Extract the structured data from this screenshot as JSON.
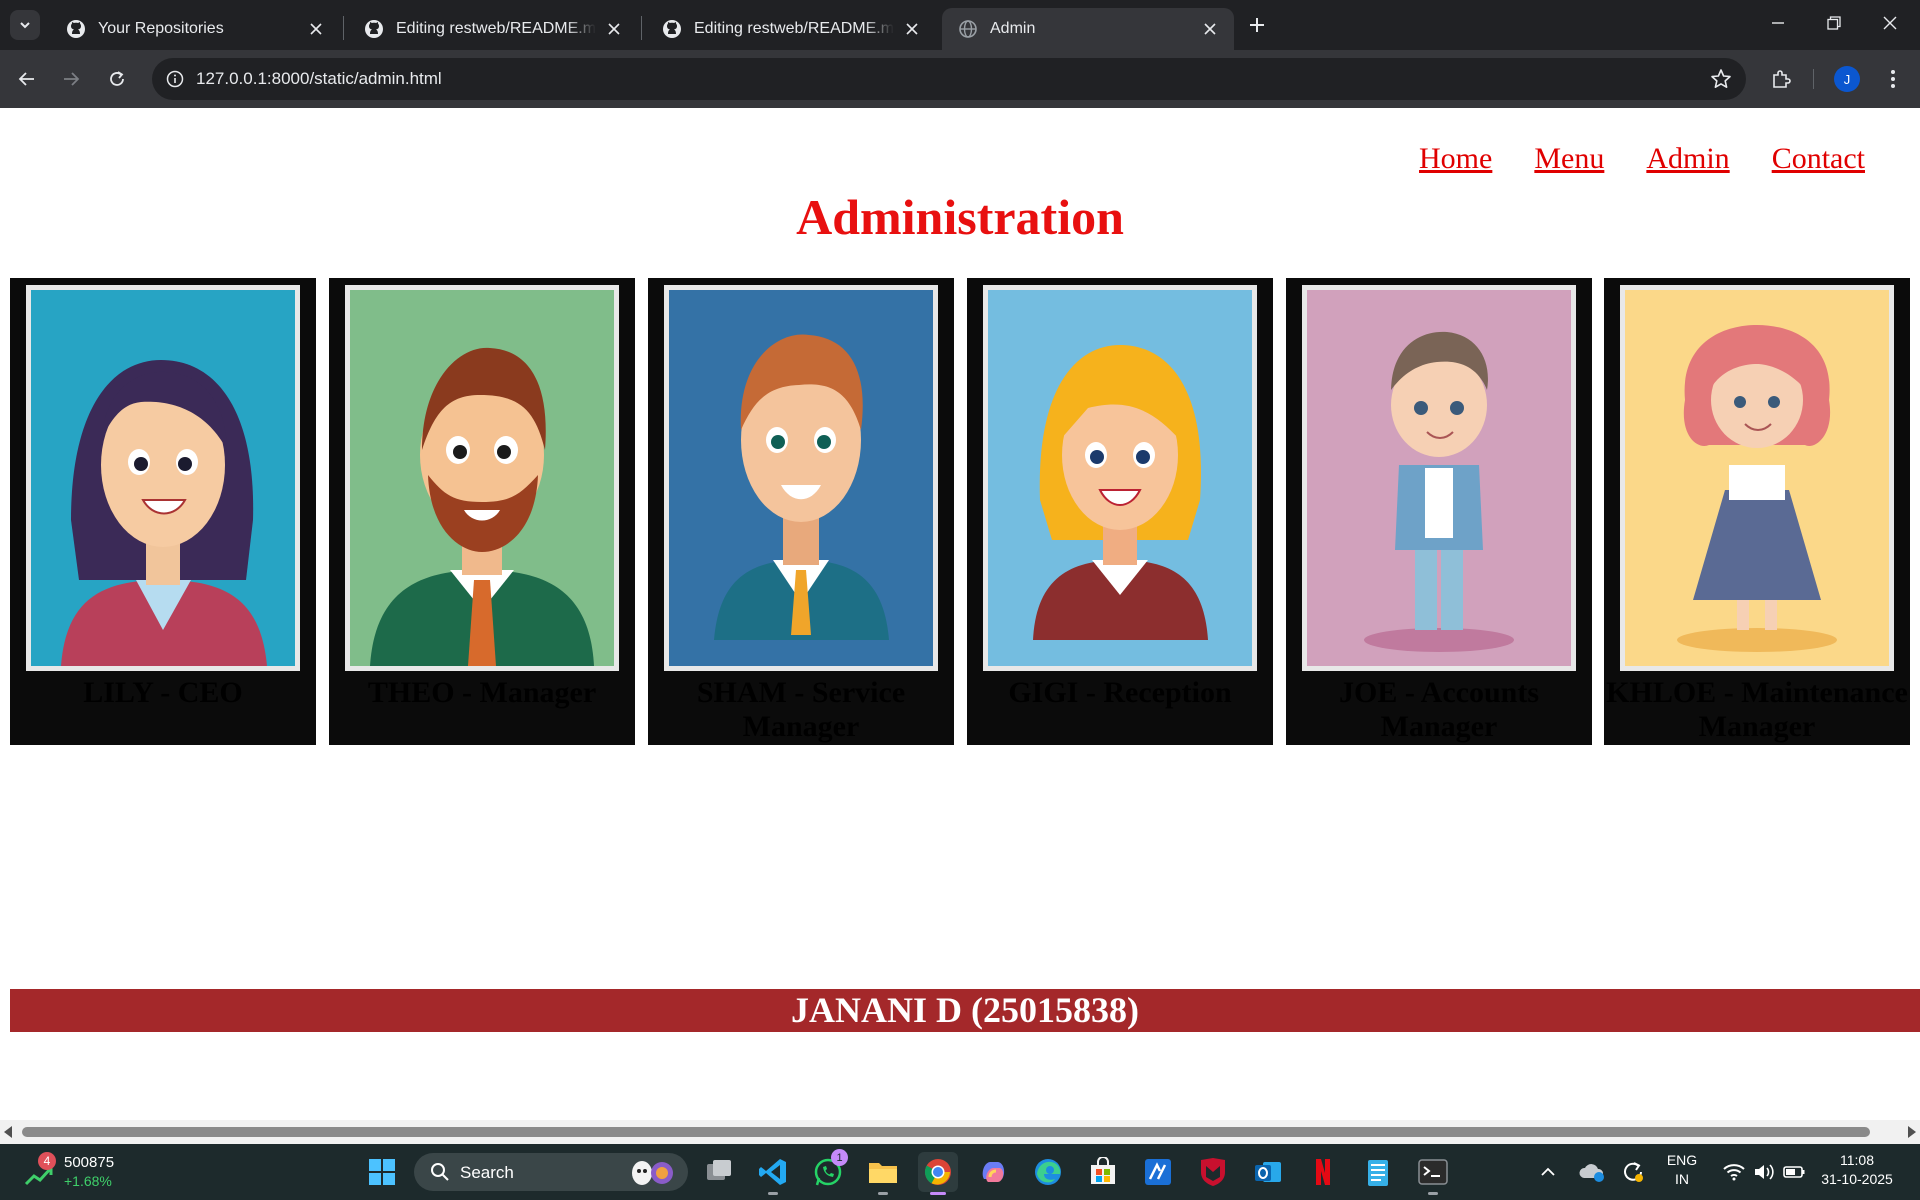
{
  "browser": {
    "tabs": [
      {
        "title": "Your Repositories",
        "icon": "github-icon",
        "active": false
      },
      {
        "title": "Editing restweb/README.md at",
        "icon": "github-icon",
        "active": false
      },
      {
        "title": "Editing restweb/README.md at",
        "icon": "github-icon",
        "active": false
      },
      {
        "title": "Admin",
        "icon": "globe-icon",
        "active": true
      }
    ],
    "url": "127.0.0.1:8000/static/admin.html",
    "profile_initial": "J"
  },
  "page": {
    "nav": [
      "Home",
      "Menu",
      "Admin",
      "Contact"
    ],
    "heading": "Administration",
    "staff": [
      {
        "caption": "LILY - CEO",
        "bg": "#27a4c4"
      },
      {
        "caption": "THEO - Manager",
        "bg": "#80bd8a"
      },
      {
        "caption": "SHAM - Service Manager",
        "bg": "#3472a6"
      },
      {
        "caption": "GIGI - Reception",
        "bg": "#74bde0"
      },
      {
        "caption": "JOE - Accounts Manager",
        "bg": "#d1a1bc"
      },
      {
        "caption": "KHLOE - Maintenance Manager",
        "bg": "#fbd889"
      }
    ],
    "footer": "JANANI D (25015838)"
  },
  "taskbar": {
    "stock": {
      "badge": "4",
      "value": "500875",
      "change": "+1.68%"
    },
    "search_label": "Search",
    "whatsapp_badge": "1",
    "lang_line1": "ENG",
    "lang_line2": "IN",
    "time": "11:08",
    "date": "31-10-2025"
  },
  "colors": {
    "accent_red": "#e81010",
    "footer_bg": "#a4282a",
    "card_bg": "#0b0b0b"
  }
}
